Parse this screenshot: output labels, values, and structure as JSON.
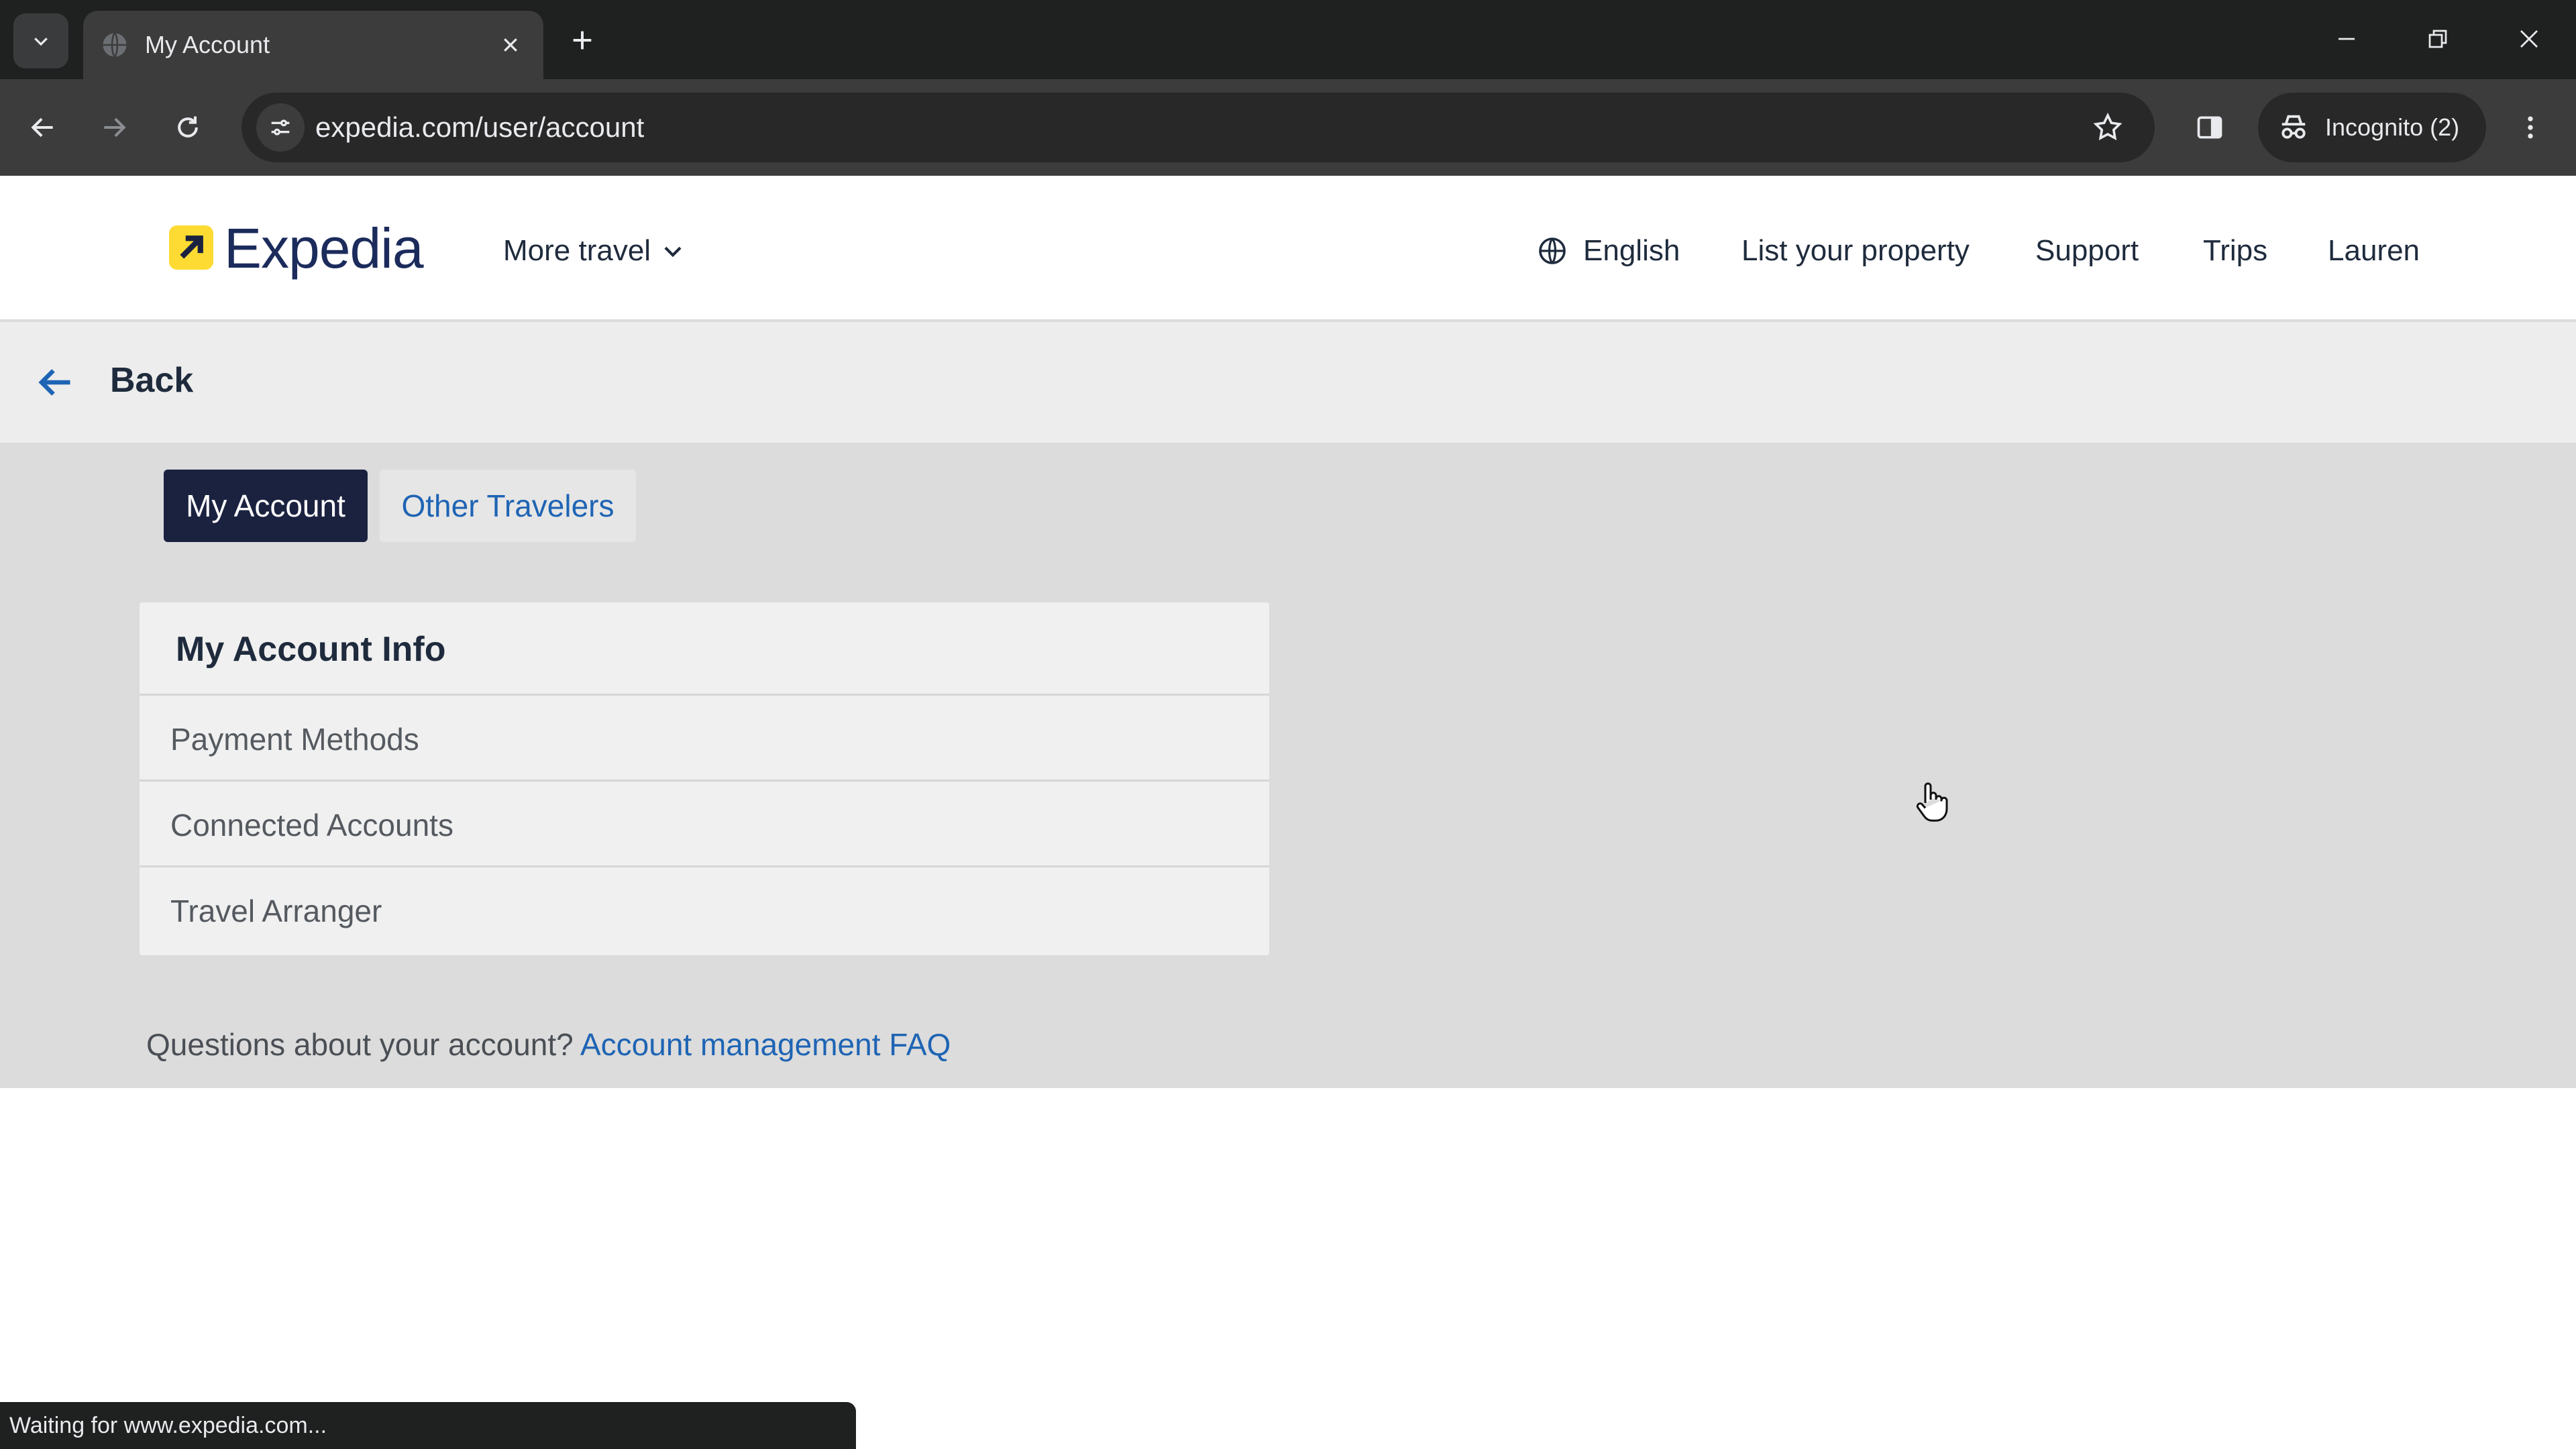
{
  "browser": {
    "tab_title": "My Account",
    "url": "expedia.com/user/account",
    "incognito_label": "Incognito (2)",
    "status_text": "Waiting for www.expedia.com..."
  },
  "header": {
    "logo": "Expedia",
    "more_travel": "More travel",
    "language": "English",
    "list_property": "List your property",
    "support": "Support",
    "trips": "Trips",
    "user": "Lauren"
  },
  "backbar": {
    "label": "Back"
  },
  "tabs": [
    {
      "label": "My Account",
      "active": true
    },
    {
      "label": "Other Travelers",
      "active": false
    }
  ],
  "card": {
    "title": "My Account Info",
    "items": [
      "Payment Methods",
      "Connected Accounts",
      "Travel Arranger"
    ]
  },
  "faq": {
    "question": "Questions about your account?",
    "link": "Account management FAQ"
  },
  "colors": {
    "brand_navy": "#1b2240",
    "link_blue": "#1e64b4",
    "logo_yellow": "#fddb32"
  }
}
